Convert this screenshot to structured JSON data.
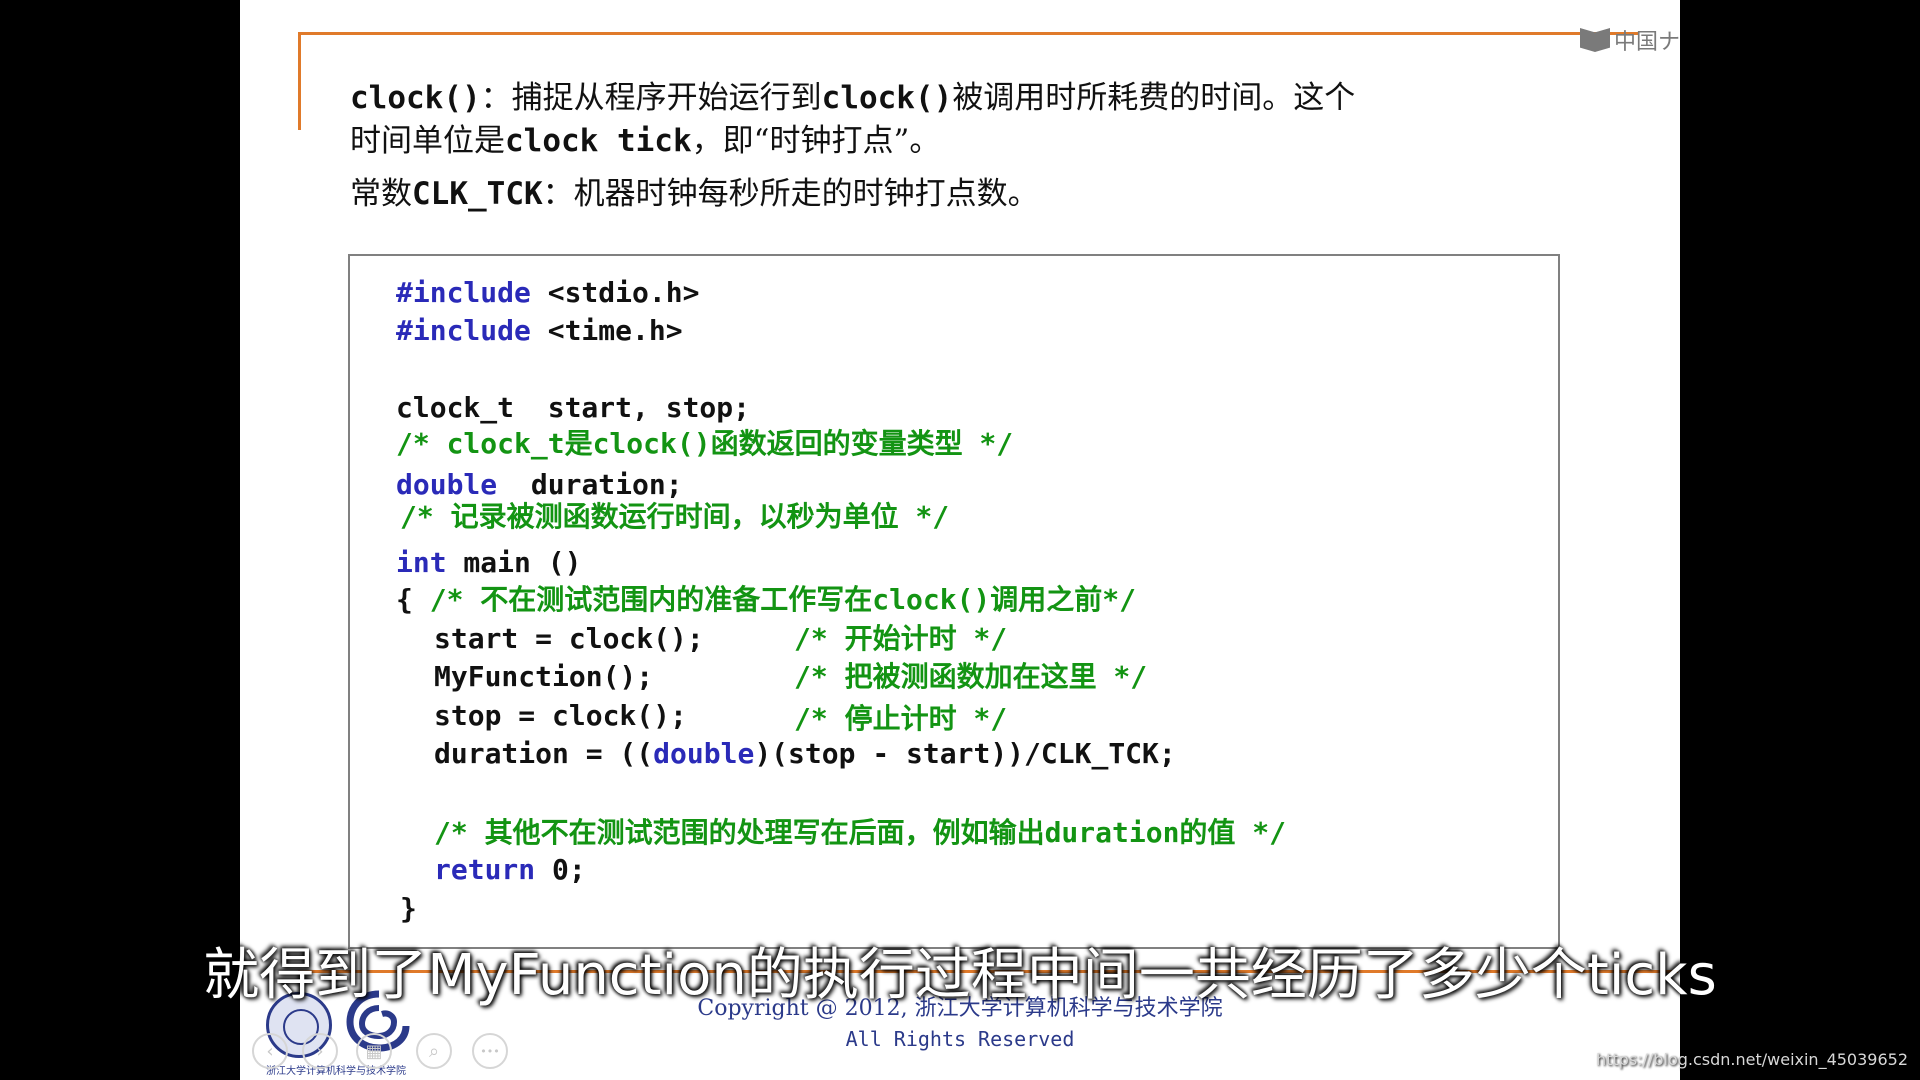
{
  "brand": {
    "label": "中国ナ"
  },
  "intro": {
    "line1_code": "clock()",
    "line1_text_a": "：捕捉从程序开始运行到",
    "line1_code_b": "clock()",
    "line1_text_b": "被调用时所耗费的时间。这个",
    "line2_text_a": "时间单位是",
    "line2_code": "clock tick",
    "line2_text_b": "，即“时钟打点”。",
    "line3_text_a": "常数",
    "line3_code": "CLK_TCK",
    "line3_text_b": "：机器时钟每秒所走的时钟打点数。"
  },
  "code": {
    "l1_kw": "#include",
    "l1_rest": " <stdio.h>",
    "l2_kw": "#include",
    "l2_rest": " <time.h>",
    "l3": "clock_t  start, stop;",
    "l4_comment": "/* clock_t是clock()函数返回的变量类型 */",
    "l5_kw": "double",
    "l5_rest": "  duration;",
    "l6_comment": "/* 记录被测函数运行时间，以秒为单位 */",
    "l7_kw": "int",
    "l7_rest": " main ()",
    "l8_brace": "{ ",
    "l8_comment": "/* 不在测试范围内的准备工作写在clock()调用之前*/",
    "l9_code": "start = clock();",
    "l9_comment": "/* 开始计时 */",
    "l10_code": "MyFunction();",
    "l10_comment": "/* 把被测函数加在这里 */",
    "l11_code": "stop = clock();",
    "l11_comment": "/* 停止计时 */",
    "l12_a": "duration = ((",
    "l12_kw": "double",
    "l12_b": ")(stop - start))/CLK_TCK;",
    "l13_comment": "/* 其他不在测试范围的处理写在后面，例如输出duration的值 */",
    "l14_kw": "return",
    "l14_rest": " 0;",
    "l15": "}"
  },
  "footer": {
    "copyright": "Copyright @ 2012, 浙江大学计算机科学与技术学院",
    "rights": "All Rights Reserved",
    "logo_caption": "浙江大学计算机科学与技术学院"
  },
  "nav": {
    "prev": "‹",
    "next": "›",
    "layout": "▦",
    "search": "⌕",
    "more": "•••"
  },
  "subtitle": "就得到了MyFunction的执行过程中间一共经历了多少个ticks",
  "watermark": "https://blog.csdn.net/weixin_45039652",
  "colors": {
    "orange_rule": "#e07a2a",
    "keyword": "#2a2ab8",
    "comment": "#139413",
    "footer_blue": "#2b3a8a"
  },
  "icons": [
    "book-icon",
    "university-seal-icon",
    "college-logo-icon",
    "prev-slide-icon",
    "next-slide-icon",
    "layout-icon",
    "search-icon",
    "more-icon",
    "mouse-cursor-icon"
  ]
}
